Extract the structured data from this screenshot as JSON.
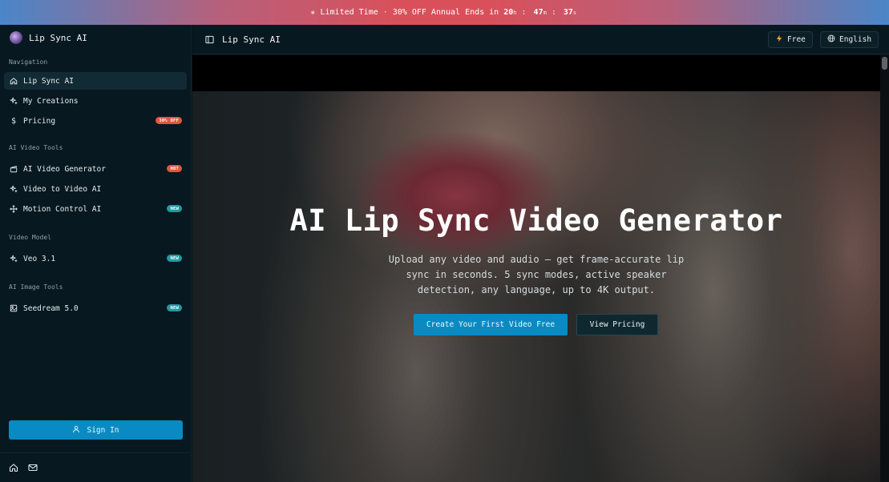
{
  "promo": {
    "label": "Limited Time",
    "dot": "·",
    "offer": "30% OFF Annual",
    "ends": "Ends in",
    "hours": "20",
    "hours_unit": "h",
    "minutes": "47",
    "minutes_unit": "m",
    "seconds": "37",
    "seconds_unit": "s",
    "sep": ":"
  },
  "brand": {
    "name": "Lip Sync AI"
  },
  "sidebar": {
    "sections": [
      {
        "label": "Navigation"
      },
      {
        "label": "AI Video Tools"
      },
      {
        "label": "Video Model"
      },
      {
        "label": "AI Image Tools"
      }
    ],
    "items": [
      {
        "label": "Lip Sync AI",
        "icon": "home-icon"
      },
      {
        "label": "My Creations",
        "icon": "sparkle-icon"
      },
      {
        "label": "Pricing",
        "icon": "dollar-icon",
        "badge": "30% OFF"
      },
      {
        "label": "AI Video Generator",
        "icon": "clapper-icon",
        "badge": "HOT"
      },
      {
        "label": "Video to Video AI",
        "icon": "sparkle-icon"
      },
      {
        "label": "Motion Control AI",
        "icon": "move-icon",
        "badge": "NEW"
      },
      {
        "label": "Veo 3.1",
        "icon": "sparkle-icon",
        "badge": "NEW"
      },
      {
        "label": "Seedream 5.0",
        "icon": "image-icon",
        "badge": "NEW"
      }
    ],
    "signin_label": "Sign In"
  },
  "topbar": {
    "title": "Lip Sync AI",
    "free_label": "Free",
    "language_label": "English"
  },
  "hero": {
    "title": "AI Lip Sync Video Generator",
    "subtitle": "Upload any video and audio — get frame-accurate lip sync in seconds. 5 sync modes, active speaker detection, any language, up to 4K output.",
    "primary_cta": "Create Your First Video Free",
    "secondary_cta": "View Pricing"
  },
  "colors": {
    "accent": "#0a8ac2",
    "badge_hot": "#e0563f",
    "badge_new": "#1f9aa0",
    "sidebar_bg": "#081820"
  }
}
